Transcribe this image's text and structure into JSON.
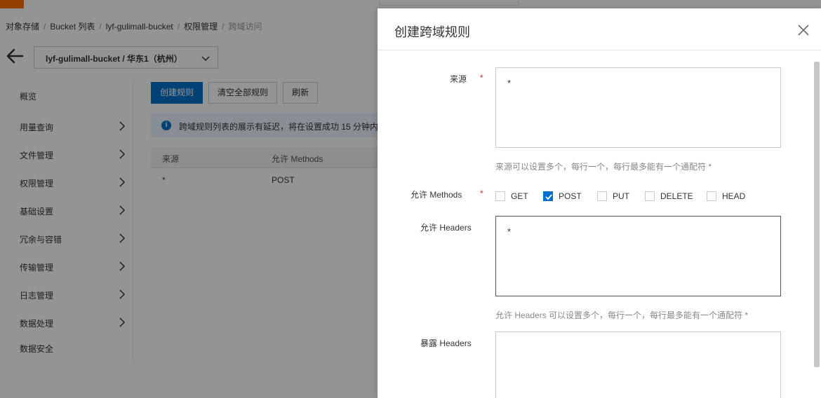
{
  "breadcrumb": [
    "对象存储",
    "Bucket 列表",
    "lyf-gulimall-bucket",
    "权限管理",
    "跨域访问"
  ],
  "bucket_select": {
    "label": "lyf-gulimall-bucket / 华东1（杭州）"
  },
  "sidenav": {
    "items": [
      {
        "label": "概览"
      },
      {
        "label": "用量查询"
      },
      {
        "label": "文件管理"
      },
      {
        "label": "权限管理"
      },
      {
        "label": "基础设置"
      },
      {
        "label": "冗余与容错"
      },
      {
        "label": "传输管理"
      },
      {
        "label": "日志管理"
      },
      {
        "label": "数据处理"
      },
      {
        "label": "数据安全"
      }
    ]
  },
  "toolbar": {
    "create_label": "创建规则",
    "clear_label": "清空全部规则",
    "refresh_label": "刷新"
  },
  "notice": {
    "text": "跨域规则列表的展示有延迟，将在设置成功 15 分钟内"
  },
  "table": {
    "columns": [
      "来源",
      "允许 Methods"
    ],
    "rows": [
      [
        "*",
        "POST"
      ]
    ]
  },
  "drawer": {
    "title": "创建跨域规则",
    "origin": {
      "label": "来源",
      "required": "*",
      "value": "*",
      "hint": "来源可以设置多个，每行一个，每行最多能有一个通配符 *"
    },
    "methods": {
      "label": "允许 Methods",
      "required": "*",
      "options": [
        {
          "label": "GET",
          "checked": false
        },
        {
          "label": "POST",
          "checked": true
        },
        {
          "label": "PUT",
          "checked": false
        },
        {
          "label": "DELETE",
          "checked": false
        },
        {
          "label": "HEAD",
          "checked": false
        }
      ]
    },
    "allow_headers": {
      "label": "允许 Headers",
      "value": "*",
      "hint": "允许 Headers 可以设置多个，每行一个，每行最多能有一个通配符 *"
    },
    "expose_headers": {
      "label": "暴露 Headers",
      "value": ""
    }
  },
  "colors": {
    "primary": "#0070cc",
    "accent": "#ff6a00",
    "required": "#d93026"
  }
}
